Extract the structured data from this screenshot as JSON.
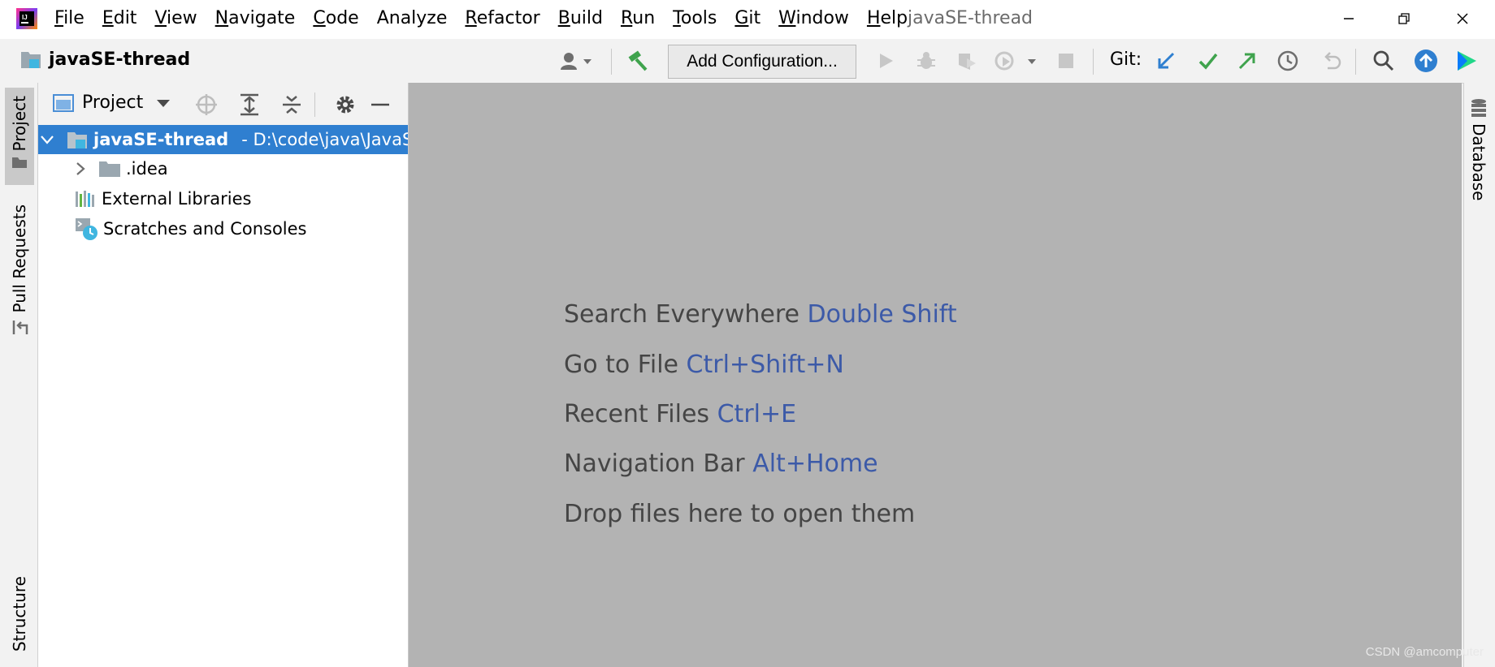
{
  "menu": {
    "items": [
      {
        "mnemonic": "F",
        "rest": "ile"
      },
      {
        "mnemonic": "E",
        "rest": "dit"
      },
      {
        "mnemonic": "V",
        "rest": "iew"
      },
      {
        "mnemonic": "N",
        "rest": "avigate"
      },
      {
        "mnemonic": "C",
        "rest": "ode"
      },
      {
        "mnemonic": "",
        "rest": "Analyze"
      },
      {
        "mnemonic": "R",
        "rest": "efactor"
      },
      {
        "mnemonic": "B",
        "rest": "uild"
      },
      {
        "mnemonic": "R",
        "rest": "un"
      },
      {
        "mnemonic": "T",
        "rest": "ools"
      },
      {
        "mnemonic": "G",
        "rest": "it"
      },
      {
        "mnemonic": "W",
        "rest": "indow"
      },
      {
        "mnemonic": "H",
        "rest": "elp"
      }
    ],
    "window_title": "javaSE-thread"
  },
  "toolbar": {
    "project_name": "javaSE-thread",
    "add_configuration": "Add Configuration...",
    "git_label": "Git:"
  },
  "left_stripe": {
    "project": "Project",
    "pull_requests": "Pull Requests",
    "structure": "Structure"
  },
  "right_stripe": {
    "database": "Database"
  },
  "project_panel": {
    "title": "Project",
    "tree": [
      {
        "label": "javaSE-thread",
        "path": "- D:\\code\\java\\JavaSE",
        "selected": true
      },
      {
        "label": ".idea"
      },
      {
        "label": "External Libraries"
      },
      {
        "label": "Scratches and Consoles"
      }
    ]
  },
  "editor": {
    "hints": [
      {
        "text": "Search Everywhere",
        "key": "Double Shift"
      },
      {
        "text": "Go to File",
        "key": "Ctrl+Shift+N"
      },
      {
        "text": "Recent Files",
        "key": "Ctrl+E"
      },
      {
        "text": "Navigation Bar",
        "key": "Alt+Home"
      },
      {
        "text": "Drop files here to open them",
        "key": ""
      }
    ],
    "watermark": "CSDN @amcomputer"
  },
  "colors": {
    "selection": "#2f7fd0",
    "editor_bg": "#b3b3b3",
    "key_text": "#3c5aa8",
    "git_blue": "#2f7fd0",
    "git_green": "#3fa34d"
  }
}
